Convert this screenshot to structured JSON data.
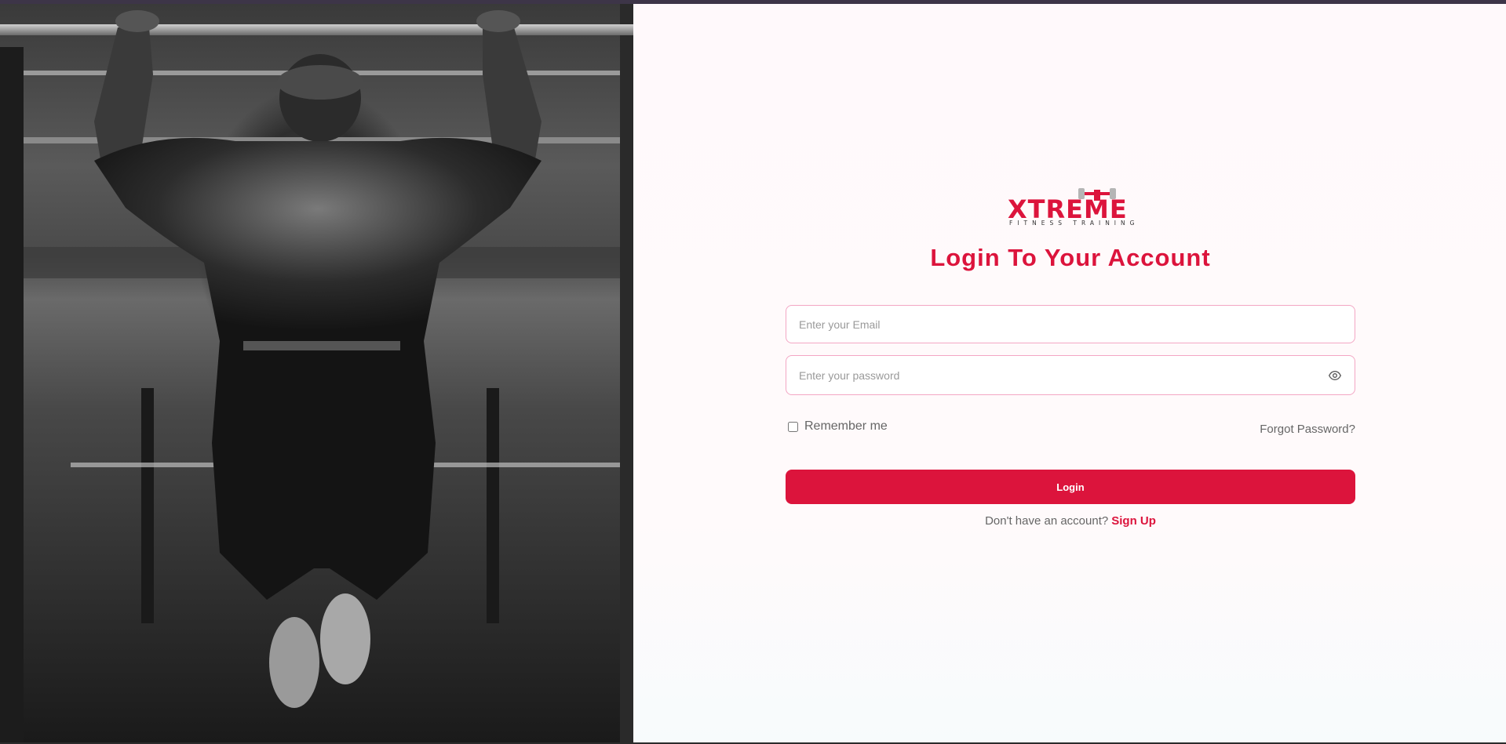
{
  "hero": {
    "image_alt": "Athlete doing pull-ups in a gym (black and white)"
  },
  "brand": {
    "name": "XTREME",
    "tagline": "FITNESS TRAINING",
    "accent_color": "#dc143c"
  },
  "login": {
    "title": "Login To Your Account",
    "email_placeholder": "Enter your Email",
    "password_placeholder": "Enter your password",
    "toggle_icon": "eye-icon",
    "remember_label": "Remember me",
    "forgot_label": "Forgot Password?",
    "submit_label": "Login",
    "signup_prompt": "Don't have an account?",
    "signup_link": "Sign Up"
  }
}
